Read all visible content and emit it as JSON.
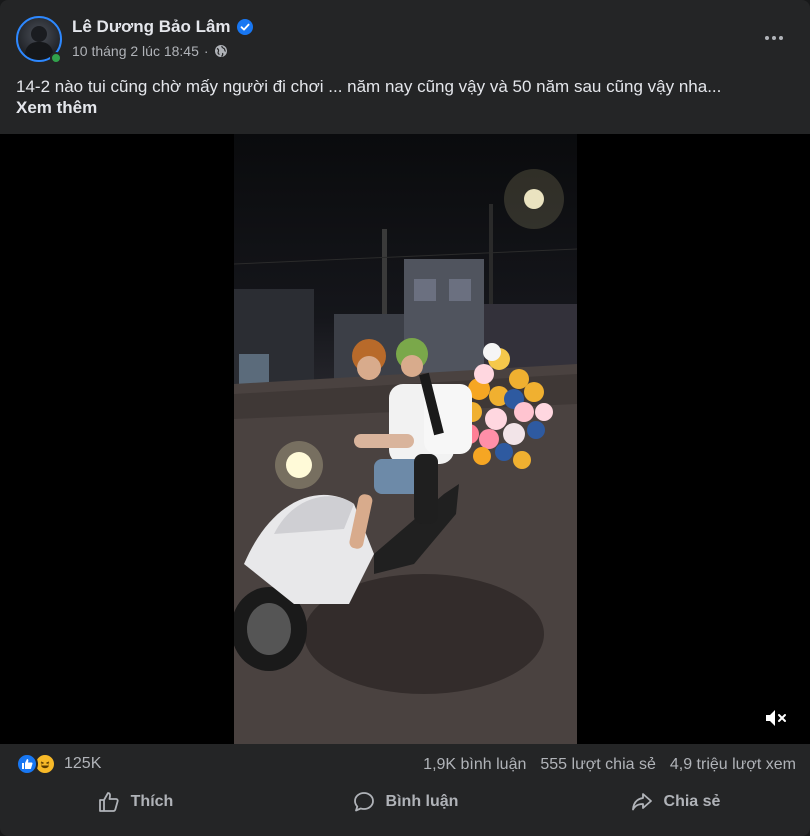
{
  "post": {
    "author": "Lê Dương Bảo Lâm",
    "timestamp": "10 tháng 2 lúc 18:45",
    "separator": "·",
    "audience_icon": "globe-icon",
    "caption": "14-2 nào tui cũng chờ mấy người đi chơi ... năm nay cũng vậy và 50 năm sau cũng vậy nha...",
    "see_more": "Xem thêm"
  },
  "stats": {
    "reaction_count": "125K",
    "comments": "1,9K bình luận",
    "shares": "555 lượt chia sẻ",
    "views": "4,9 triệu lượt xem"
  },
  "actions": {
    "like": "Thích",
    "comment": "Bình luận",
    "share": "Chia sẻ"
  },
  "colors": {
    "background": "#242526",
    "text": "#e4e6eb",
    "secondary": "#b0b3b8",
    "accent": "#1877f2",
    "online": "#31a24c"
  }
}
